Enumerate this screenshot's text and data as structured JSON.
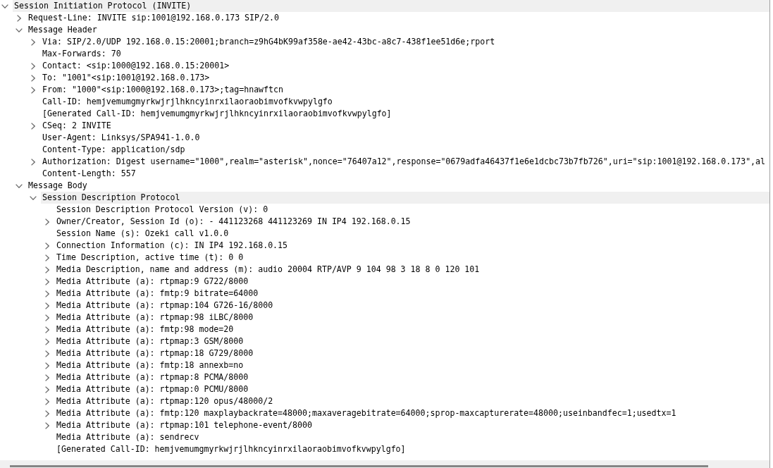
{
  "packet_details": {
    "tree": [
      {
        "label": "Session Initiation Protocol (INVITE)",
        "kind": "branch",
        "expanded": true,
        "selected": true,
        "children": [
          {
            "label": "Request-Line: INVITE sip:1001@192.168.0.173 SIP/2.0",
            "kind": "branch",
            "expanded": false,
            "selected": false
          },
          {
            "label": "Message Header",
            "kind": "branch",
            "expanded": true,
            "selected": false,
            "children": [
              {
                "label": "Via: SIP/2.0/UDP 192.168.0.15:20001;branch=z9hG4bK99af358e-ae42-43bc-a8c7-438f1ee51d6e;rport",
                "kind": "branch",
                "expanded": false,
                "selected": false
              },
              {
                "label": "Max-Forwards: 70",
                "kind": "leaf",
                "selected": false
              },
              {
                "label": "Contact: <sip:1000@192.168.0.15:20001>",
                "kind": "branch",
                "expanded": false,
                "selected": false
              },
              {
                "label": "To: \"1001\"<sip:1001@192.168.0.173>",
                "kind": "branch",
                "expanded": false,
                "selected": false
              },
              {
                "label": "From: \"1000\"<sip:1000@192.168.0.173>;tag=hnawftcn",
                "kind": "branch",
                "expanded": false,
                "selected": false
              },
              {
                "label": "Call-ID: hemjvemumgmyrkwjrjlhkncyinrxilaoraobimvofkvwpylgfo",
                "kind": "leaf",
                "selected": false
              },
              {
                "label": "[Generated Call-ID: hemjvemumgmyrkwjrjlhkncyinrxilaoraobimvofkvwpylgfo]",
                "kind": "leaf",
                "selected": false
              },
              {
                "label": "CSeq: 2 INVITE",
                "kind": "branch",
                "expanded": false,
                "selected": false
              },
              {
                "label": "User-Agent: Linksys/SPA941-1.0.0",
                "kind": "leaf",
                "selected": false
              },
              {
                "label": "Content-Type: application/sdp",
                "kind": "leaf",
                "selected": false
              },
              {
                "label": "Authorization: Digest username=\"1000\",realm=\"asterisk\",nonce=\"76407a12\",response=\"0679adfa46437f1e6e1dcbc73b7fb726\",uri=\"sip:1001@192.168.0.173\",al",
                "kind": "branch",
                "expanded": false,
                "selected": false
              },
              {
                "label": "Content-Length: 557",
                "kind": "leaf",
                "selected": false
              }
            ]
          },
          {
            "label": "Message Body",
            "kind": "branch",
            "expanded": true,
            "selected": false,
            "children": [
              {
                "label": "Session Description Protocol",
                "kind": "branch",
                "expanded": true,
                "selected": true,
                "children": [
                  {
                    "label": "Session Description Protocol Version (v): 0",
                    "kind": "leaf",
                    "selected": false
                  },
                  {
                    "label": "Owner/Creator, Session Id (o): - 441123268 441123269 IN IP4 192.168.0.15",
                    "kind": "branch",
                    "expanded": false,
                    "selected": false
                  },
                  {
                    "label": "Session Name (s): Ozeki call v1.0.0",
                    "kind": "leaf",
                    "selected": false
                  },
                  {
                    "label": "Connection Information (c): IN IP4 192.168.0.15",
                    "kind": "branch",
                    "expanded": false,
                    "selected": false
                  },
                  {
                    "label": "Time Description, active time (t): 0 0",
                    "kind": "branch",
                    "expanded": false,
                    "selected": false
                  },
                  {
                    "label": "Media Description, name and address (m): audio 20004 RTP/AVP 9 104 98 3 18 8 0 120 101",
                    "kind": "branch",
                    "expanded": false,
                    "selected": false
                  },
                  {
                    "label": "Media Attribute (a): rtpmap:9 G722/8000",
                    "kind": "branch",
                    "expanded": false,
                    "selected": false
                  },
                  {
                    "label": "Media Attribute (a): fmtp:9 bitrate=64000",
                    "kind": "branch",
                    "expanded": false,
                    "selected": false
                  },
                  {
                    "label": "Media Attribute (a): rtpmap:104 G726-16/8000",
                    "kind": "branch",
                    "expanded": false,
                    "selected": false
                  },
                  {
                    "label": "Media Attribute (a): rtpmap:98 iLBC/8000",
                    "kind": "branch",
                    "expanded": false,
                    "selected": false
                  },
                  {
                    "label": "Media Attribute (a): fmtp:98 mode=20",
                    "kind": "branch",
                    "expanded": false,
                    "selected": false
                  },
                  {
                    "label": "Media Attribute (a): rtpmap:3 GSM/8000",
                    "kind": "branch",
                    "expanded": false,
                    "selected": false
                  },
                  {
                    "label": "Media Attribute (a): rtpmap:18 G729/8000",
                    "kind": "branch",
                    "expanded": false,
                    "selected": false
                  },
                  {
                    "label": "Media Attribute (a): fmtp:18 annexb=no",
                    "kind": "branch",
                    "expanded": false,
                    "selected": false
                  },
                  {
                    "label": "Media Attribute (a): rtpmap:8 PCMA/8000",
                    "kind": "branch",
                    "expanded": false,
                    "selected": false
                  },
                  {
                    "label": "Media Attribute (a): rtpmap:0 PCMU/8000",
                    "kind": "branch",
                    "expanded": false,
                    "selected": false
                  },
                  {
                    "label": "Media Attribute (a): rtpmap:120 opus/48000/2",
                    "kind": "branch",
                    "expanded": false,
                    "selected": false
                  },
                  {
                    "label": "Media Attribute (a): fmtp:120 maxplaybackrate=48000;maxaveragebitrate=64000;sprop-maxcapturerate=48000;useinbandfec=1;usedtx=1",
                    "kind": "branch",
                    "expanded": false,
                    "selected": false
                  },
                  {
                    "label": "Media Attribute (a): rtpmap:101 telephone-event/8000",
                    "kind": "branch",
                    "expanded": false,
                    "selected": false
                  },
                  {
                    "label": "Media Attribute (a): sendrecv",
                    "kind": "leaf",
                    "selected": false
                  },
                  {
                    "label": "[Generated Call-ID: hemjvemumgmyrkwjrjlhkncyinrxilaoraobimvofkvwpylgfo]",
                    "kind": "leaf",
                    "selected": false
                  }
                ]
              }
            ]
          }
        ]
      }
    ]
  }
}
